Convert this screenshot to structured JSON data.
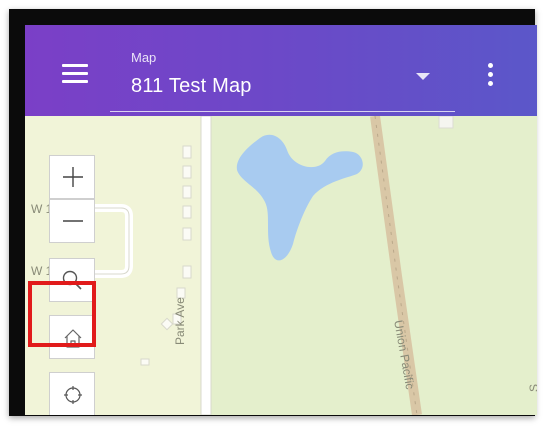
{
  "header": {
    "map_label": "Map",
    "map_name": "811 Test Map"
  },
  "map": {
    "street_labels": {
      "park_ave": "Park Ave",
      "union_pacific": "Union Pacific",
      "w_top": "W 1",
      "w_mid": "W 1",
      "s_partial": "S"
    }
  },
  "controls": {
    "zoom_in_symbol": "+",
    "zoom_out_symbol": "—"
  },
  "colors": {
    "appbar_start": "#7b3fc7",
    "appbar_end": "#5b57c9",
    "map_land": "#f1f4d8",
    "park": "#e4efcc",
    "water": "#a8cbf0",
    "highlight": "#e11b1b"
  },
  "icons": [
    "menu-icon",
    "dropdown-caret-icon",
    "more-vert-icon",
    "zoom-in-icon",
    "zoom-out-icon",
    "search-icon",
    "home-icon",
    "locate-icon"
  ]
}
